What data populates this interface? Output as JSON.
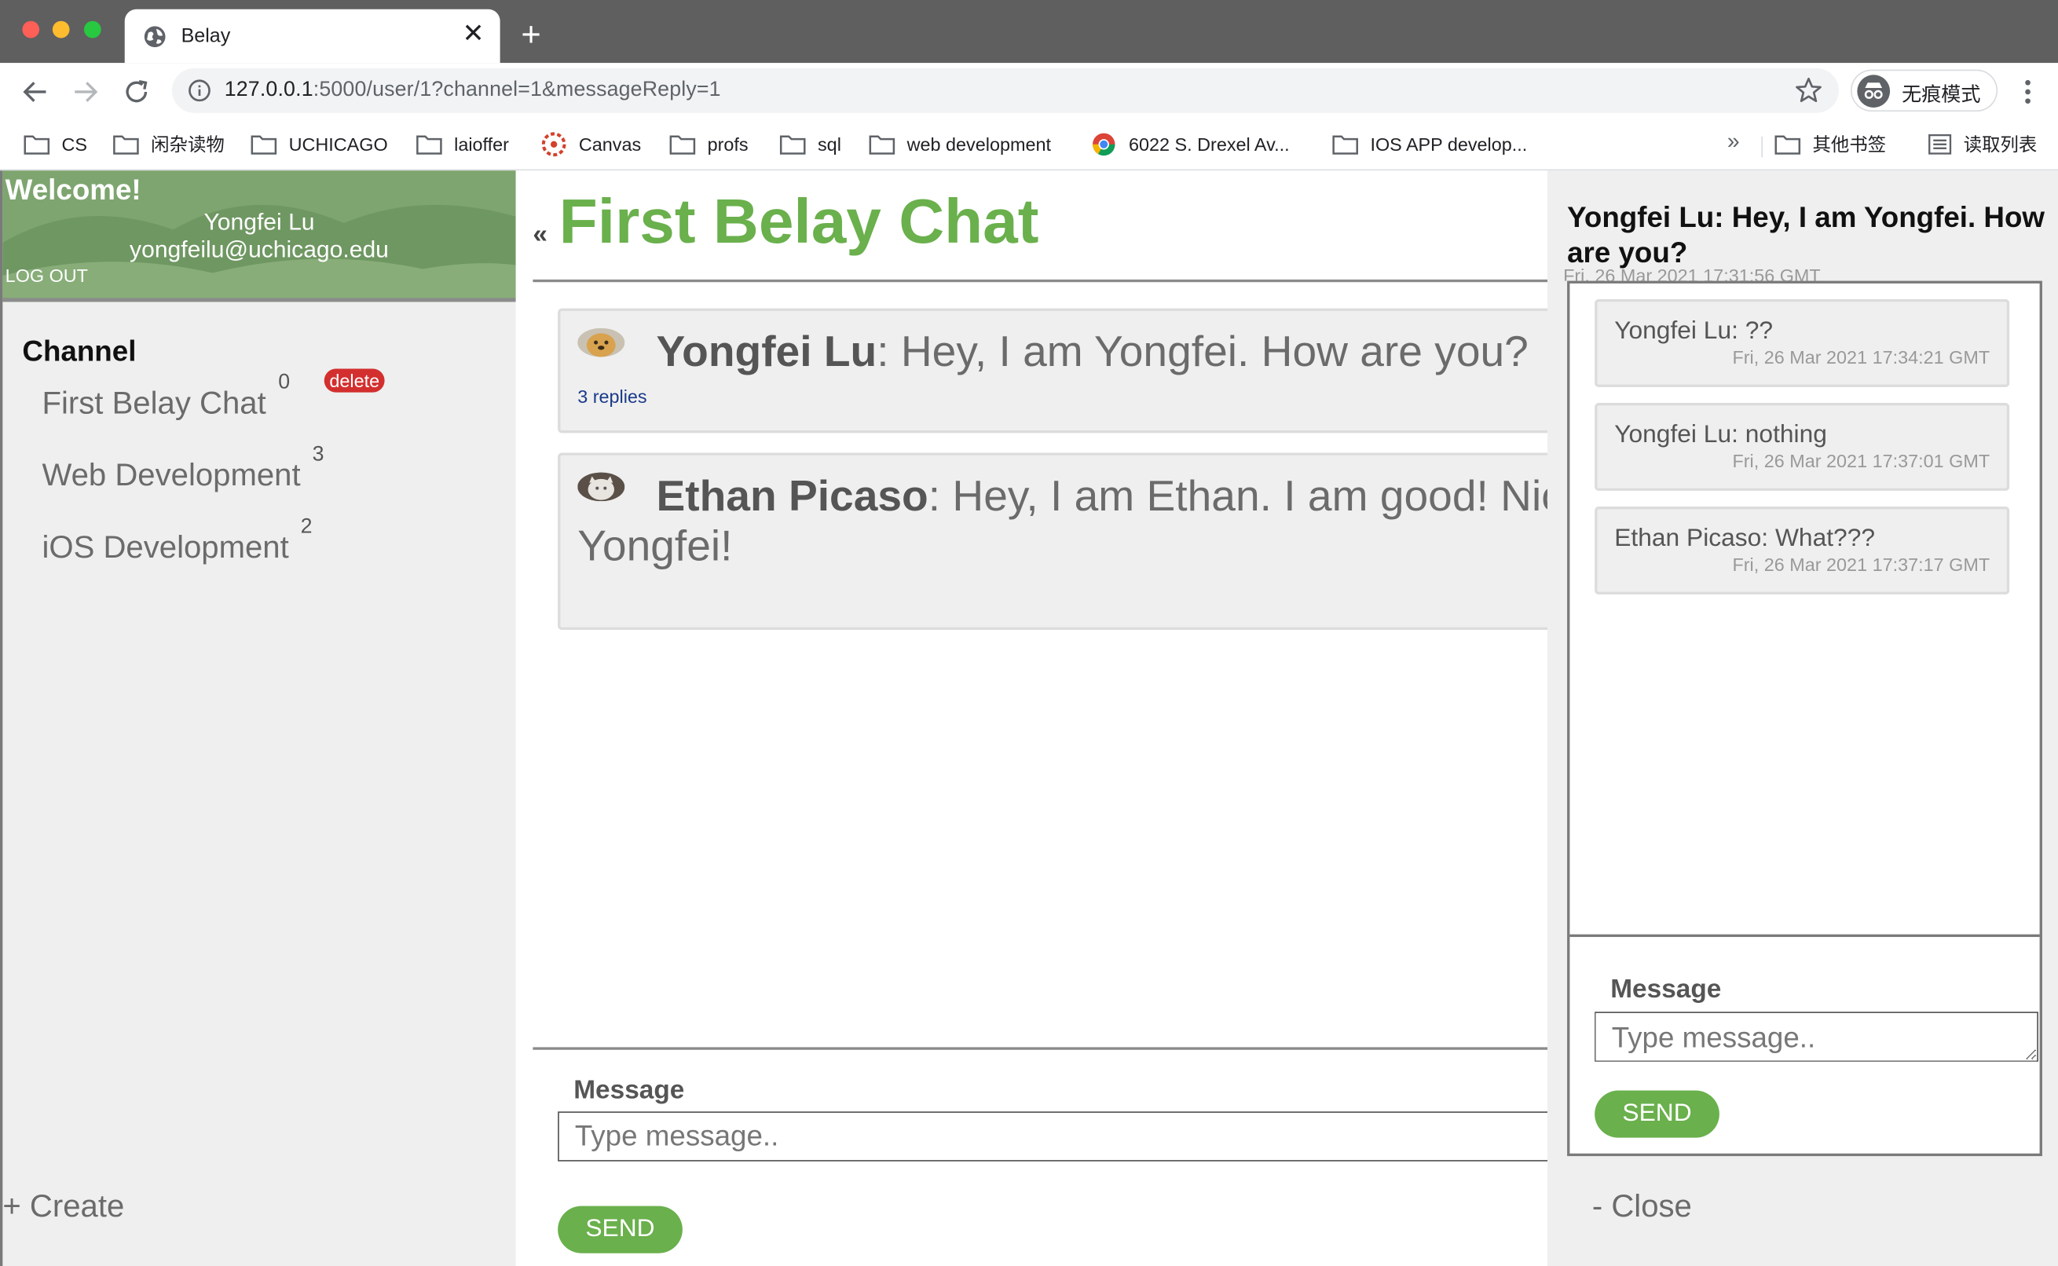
{
  "browser": {
    "tab_title": "Belay",
    "url_host": "127.0.0.1",
    "url_rest": ":5000/user/1?channel=1&messageReply=1",
    "incognito_label": "无痕模式",
    "bookmarks": [
      {
        "label": "CS",
        "icon": "folder-icon"
      },
      {
        "label": "闲杂读物",
        "icon": "folder-icon"
      },
      {
        "label": "UCHICAGO",
        "icon": "folder-icon"
      },
      {
        "label": "laioffer",
        "icon": "folder-icon"
      },
      {
        "label": "Canvas",
        "icon": "canvas-logo-icon"
      },
      {
        "label": "profs",
        "icon": "folder-icon"
      },
      {
        "label": "sql",
        "icon": "folder-icon"
      },
      {
        "label": "web development",
        "icon": "folder-icon"
      },
      {
        "label": "6022 S. Drexel Av...",
        "icon": "chrome-logo-icon"
      },
      {
        "label": "IOS APP develop...",
        "icon": "folder-icon"
      }
    ],
    "more_bookmarks": "»",
    "other_bookmarks": "其他书签",
    "reading_list": "读取列表"
  },
  "sidebar": {
    "welcome": "Welcome!",
    "user_name": "Yongfei Lu",
    "user_email": "yongfeilu@uchicago.edu",
    "logout": "LOG OUT",
    "heading": "Channel",
    "channels": [
      {
        "name": "First Belay Chat",
        "count": "0"
      },
      {
        "name": "Web Development",
        "count": "3"
      },
      {
        "name": "iOS Development",
        "count": "2"
      }
    ],
    "delete_label": "delete",
    "create_label": "+ Create"
  },
  "main": {
    "back": "«",
    "title": "First Belay Chat",
    "messages": [
      {
        "author": "Yongfei Lu",
        "text": ": Hey, I am Yongfei. How are you?",
        "replies": "3 replies"
      },
      {
        "author": "Ethan Picaso",
        "text": ": Hey, I am Ethan. I am good! Nice to meet you",
        "text_line2": "Yongfei!"
      }
    ],
    "compose_label": "Message",
    "compose_placeholder": "Type message..",
    "send_label": "SEND"
  },
  "thread": {
    "title": "Yongfei Lu: Hey, I am Yongfei. How are you?",
    "timestamp": "Fri, 26 Mar 2021 17:31:56 GMT",
    "replies": [
      {
        "text": "Yongfei Lu: ??",
        "time": "Fri, 26 Mar 2021 17:34:21 GMT"
      },
      {
        "text": "Yongfei Lu: nothing",
        "time": "Fri, 26 Mar 2021 17:37:01 GMT"
      },
      {
        "text": "Ethan Picaso: What???",
        "time": "Fri, 26 Mar 2021 17:37:17 GMT"
      }
    ],
    "compose_label": "Message",
    "compose_placeholder": "Type message..",
    "send_label": "SEND",
    "close_label": "- Close"
  },
  "colors": {
    "accent_green": "#6ab04c",
    "delete_red": "#d32f2f",
    "profile_bg": "#7aa26b"
  }
}
